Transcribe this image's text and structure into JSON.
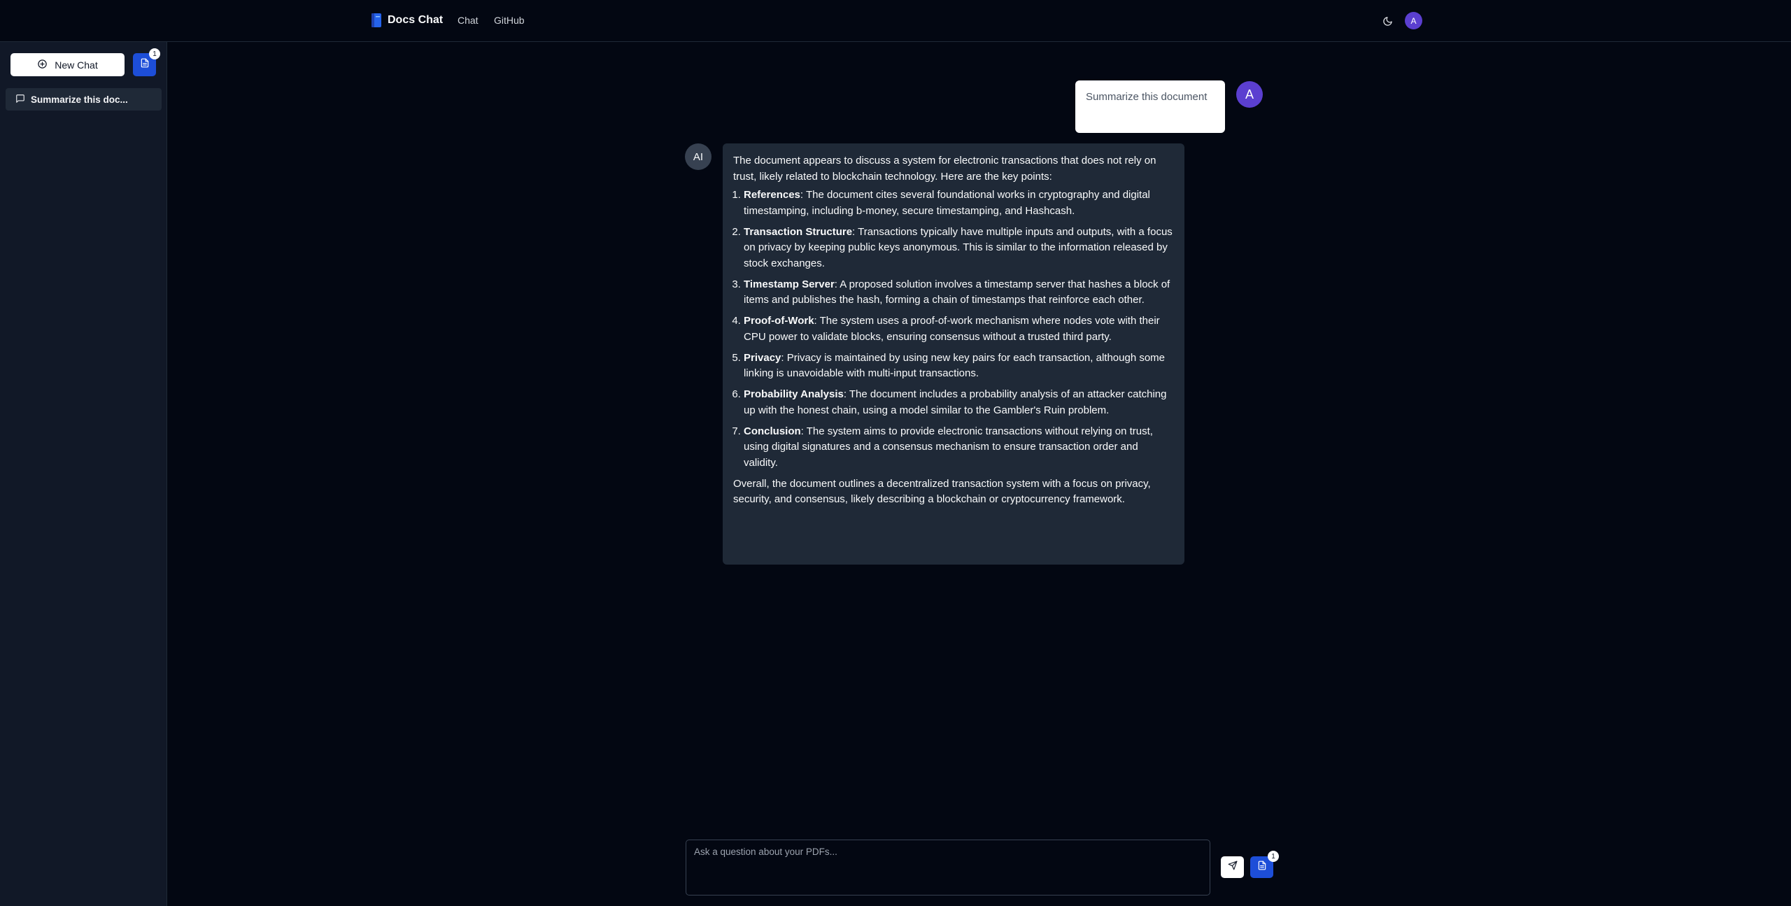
{
  "header": {
    "title": "Docs Chat",
    "nav": [
      {
        "label": "Chat"
      },
      {
        "label": "GitHub"
      }
    ],
    "avatar_initial": "A"
  },
  "sidebar": {
    "new_chat_label": "New Chat",
    "docs_count": "1",
    "history": [
      {
        "label": "Summarize this doc..."
      }
    ]
  },
  "conversation": {
    "user_message": "Summarize this document",
    "user_avatar": "A",
    "ai_avatar": "AI",
    "ai_response": {
      "intro": "The document appears to discuss a system for electronic transactions that does not rely on trust, likely related to blockchain technology. Here are the key points:",
      "points": [
        {
          "title": "References",
          "text": ": The document cites several foundational works in cryptography and digital timestamping, including b-money, secure timestamping, and Hashcash."
        },
        {
          "title": "Transaction Structure",
          "text": ": Transactions typically have multiple inputs and outputs, with a focus on privacy by keeping public keys anonymous. This is similar to the information released by stock exchanges."
        },
        {
          "title": "Timestamp Server",
          "text": ": A proposed solution involves a timestamp server that hashes a block of items and publishes the hash, forming a chain of timestamps that reinforce each other."
        },
        {
          "title": "Proof-of-Work",
          "text": ": The system uses a proof-of-work mechanism where nodes vote with their CPU power to validate blocks, ensuring consensus without a trusted third party."
        },
        {
          "title": "Privacy",
          "text": ": Privacy is maintained by using new key pairs for each transaction, although some linking is unavoidable with multi-input transactions."
        },
        {
          "title": "Probability Analysis",
          "text": ": The document includes a probability analysis of an attacker catching up with the honest chain, using a model similar to the Gambler's Ruin problem."
        },
        {
          "title": "Conclusion",
          "text": ": The system aims to provide electronic transactions without relying on trust, using digital signatures and a consensus mechanism to ensure transaction order and validity."
        }
      ],
      "summary": "Overall, the document outlines a decentralized transaction system with a focus on privacy, security, and consensus, likely describing a blockchain or cryptocurrency framework."
    }
  },
  "composer": {
    "placeholder": "Ask a question about your PDFs...",
    "docs_count": "1"
  },
  "colors": {
    "background": "#030712",
    "sidebar": "#111827",
    "ai_bubble": "#1f2937",
    "accent_blue": "#1d4ed8",
    "avatar_purple": "#5b3fd0"
  }
}
